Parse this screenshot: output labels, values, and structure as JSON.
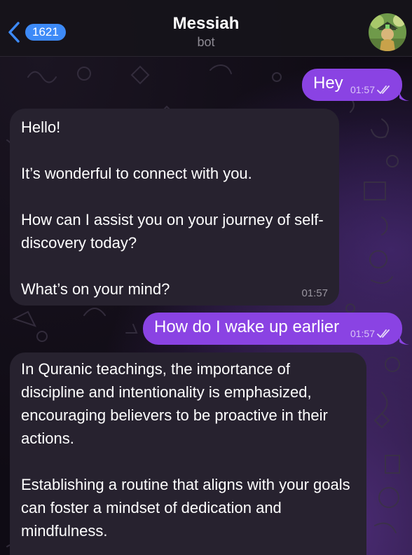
{
  "header": {
    "back_badge": "1621",
    "title": "Messiah",
    "subtitle": "bot"
  },
  "messages": [
    {
      "direction": "outgoing",
      "text": "Hey",
      "time": "01:57",
      "status": "read"
    },
    {
      "direction": "incoming",
      "paragraphs": [
        "Hello!",
        "It’s wonderful to connect with you.",
        "How can I assist you on your journey of self-discovery today?",
        "What’s on your mind?"
      ],
      "time": "01:57"
    },
    {
      "direction": "outgoing",
      "text": "How do I wake up earlier",
      "time": "01:57",
      "status": "read"
    },
    {
      "direction": "incoming",
      "paragraphs": [
        "In Quranic teachings, the importance of discipline and intentionality is emphasized, encouraging believers to be proactive in their actions.",
        "Establishing a routine that aligns with your goals can foster a mindset of dedication and mindfulness."
      ]
    }
  ],
  "colors": {
    "outgoing_bubble": "#8a43e3",
    "incoming_bubble": "#27222f",
    "badge": "#3d8af7",
    "background": "#0f0b14"
  },
  "icons": {
    "back": "chevron-left-icon",
    "read_status": "double-check-icon"
  }
}
